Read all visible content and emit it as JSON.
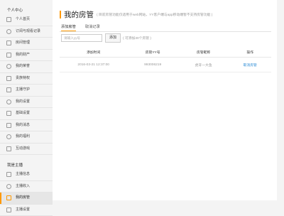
{
  "sidebar": {
    "personal_title": "个人中心",
    "personal_items": [
      {
        "label": "个人首页",
        "icon": "home-icon"
      },
      {
        "label": "订阅与观看记录",
        "icon": "list-icon"
      },
      {
        "label": "房间管理",
        "icon": "room-icon"
      },
      {
        "label": "我的财产",
        "icon": "wallet-icon"
      },
      {
        "label": "我的荣誉",
        "icon": "medal-icon"
      },
      {
        "label": "贵族特权",
        "icon": "crown-icon"
      },
      {
        "label": "主播守护",
        "icon": "shield-icon"
      },
      {
        "label": "我的设置",
        "icon": "gear-icon"
      },
      {
        "label": "基础设置",
        "icon": "settings-icon"
      },
      {
        "label": "我的消息",
        "icon": "message-icon"
      },
      {
        "label": "我的福利",
        "icon": "gift-icon"
      },
      {
        "label": "互动游戏",
        "icon": "game-icon"
      }
    ],
    "anchor_title": "我是主播",
    "anchor_items": [
      {
        "label": "主播信息",
        "icon": "id-card-icon"
      },
      {
        "label": "主播收入",
        "icon": "income-icon"
      },
      {
        "label": "我的房管",
        "icon": "admin-icon",
        "active": true
      },
      {
        "label": "主播设置",
        "icon": "gear-icon"
      }
    ]
  },
  "main": {
    "title": "我的房管",
    "note": "( 目前房管功能仅适用于web网站，YY客户端与app移动端暂不支持房管功能 )",
    "tabs": [
      "添加房管",
      "取消记录"
    ],
    "input_placeholder": "请输入yy号",
    "add_button": "添加",
    "limit_text": "( 可添加30个房管 )",
    "columns": [
      "添加时间",
      "房管YY号",
      "房管昵称",
      "操作"
    ],
    "rows": [
      {
        "time": "2016-03-21 12:37:00",
        "yy": "993006219",
        "nickname": "虎牙一大鱼",
        "action": "取消房管"
      }
    ]
  },
  "colors": {
    "accent": "#ff9900",
    "link": "#2a8bd6"
  }
}
